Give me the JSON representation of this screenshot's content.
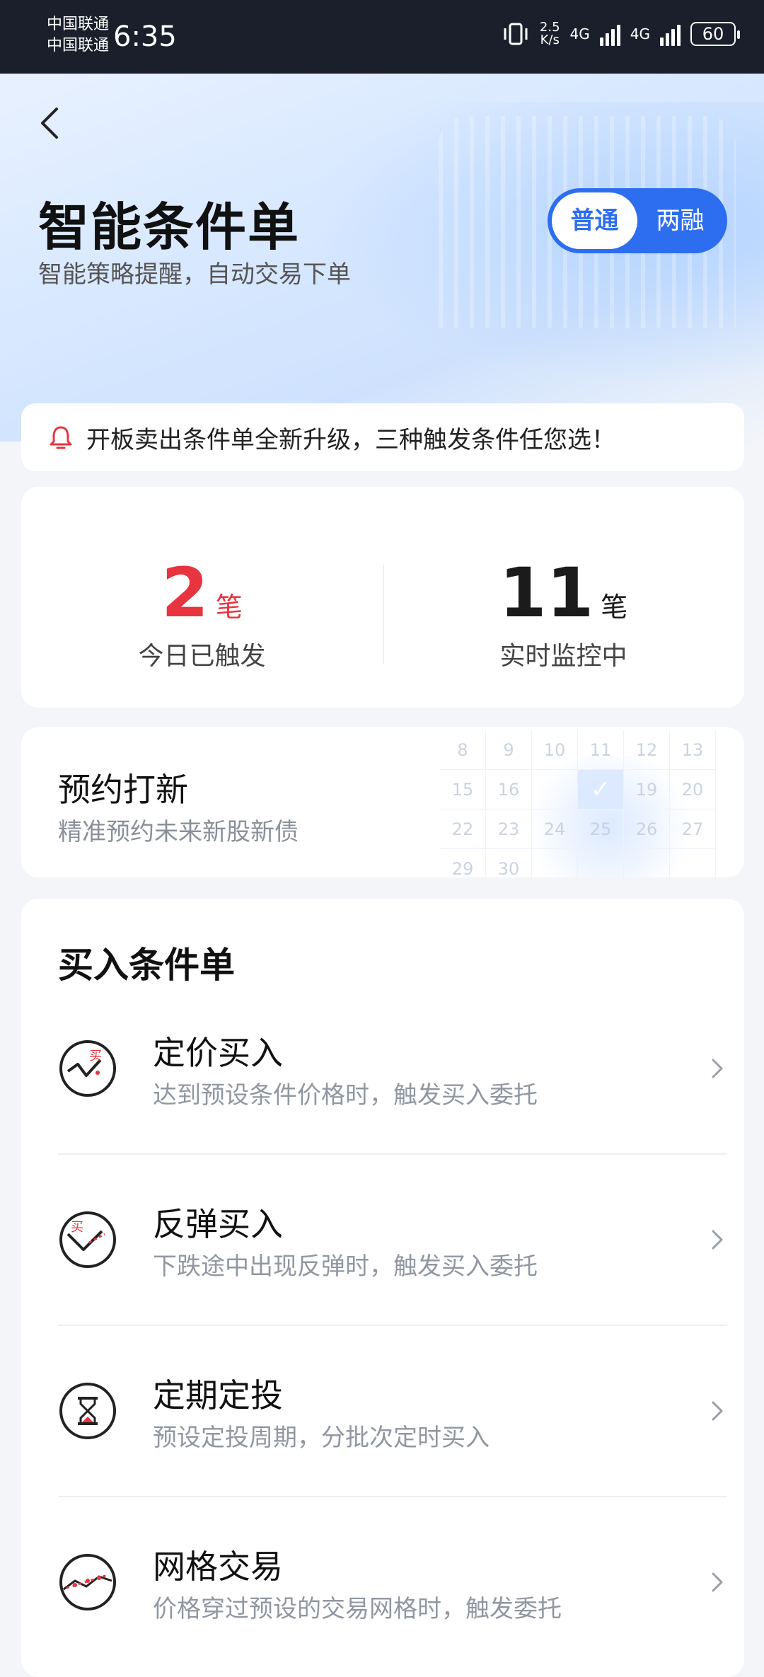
{
  "status_bar": {
    "carrier_1": "中国联通",
    "carrier_2": "中国联通",
    "time": "6:35",
    "net_speed_value": "2.5",
    "net_speed_unit": "K/s",
    "net_1": "4G",
    "net_2": "4G",
    "battery": "60"
  },
  "header": {
    "title": "智能条件单",
    "subtitle": "智能策略提醒，自动交易下单",
    "toggle": {
      "active": "普通",
      "inactive": "两融"
    }
  },
  "notice": {
    "text": "开板卖出条件单全新升级，三种触发条件任您选！"
  },
  "stats": {
    "triggered": {
      "value": "2",
      "unit": "笔",
      "label": "今日已触发"
    },
    "monitoring": {
      "value": "11",
      "unit": "笔",
      "label": "实时监控中"
    }
  },
  "ipo": {
    "title": "预约打新",
    "subtitle": "精准预约未来新股新债",
    "calendar_days": [
      "8",
      "9",
      "10",
      "11",
      "12",
      "13",
      "15",
      "16",
      "",
      "✓",
      "19",
      "20",
      "22",
      "23",
      "24",
      "25",
      "26",
      "27",
      "29",
      "30",
      "",
      "",
      "",
      ""
    ]
  },
  "buy_section": {
    "heading": "买入条件单",
    "items": [
      {
        "name": "定价买入",
        "desc": "达到预设条件价格时，触发买入委托",
        "icon": "price-buy-icon"
      },
      {
        "name": "反弹买入",
        "desc": "下跌途中出现反弹时，触发买入委托",
        "icon": "rebound-buy-icon"
      },
      {
        "name": "定期定投",
        "desc": "预设定投周期，分批次定时买入",
        "icon": "hourglass-icon"
      },
      {
        "name": "网格交易",
        "desc": "价格穿过预设的交易网格时，触发委托",
        "icon": "grid-trade-icon"
      }
    ]
  },
  "colors": {
    "accent": "#2d6ef0",
    "red": "#e8343f"
  }
}
